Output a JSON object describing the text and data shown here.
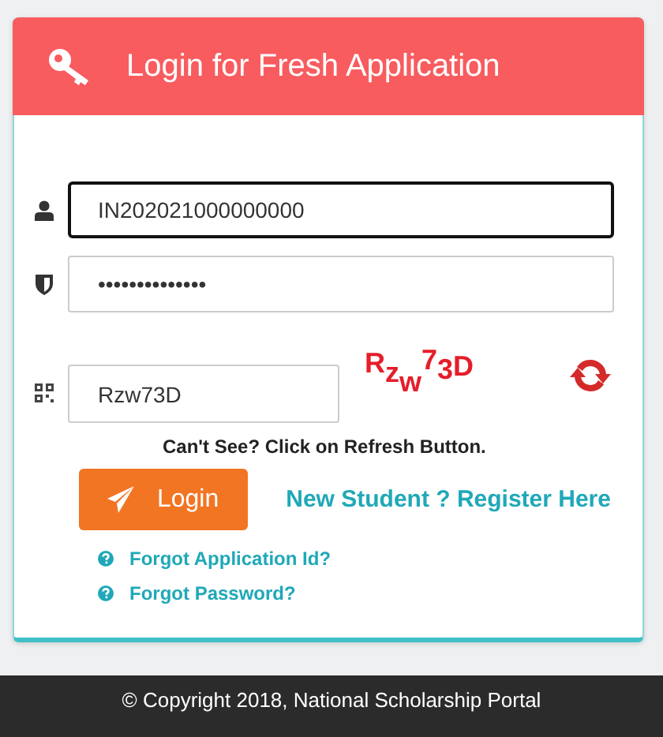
{
  "header": {
    "title": "Login for Fresh Application"
  },
  "fields": [
    {
      "kind": "user",
      "value": "IN202021000000000",
      "focused": true
    },
    {
      "kind": "password",
      "value": "••••••••••••••",
      "focused": false
    }
  ],
  "captcha": {
    "image_text": "Rzw73D",
    "value": "Rzw73D",
    "hint": "Can't See? Click on Refresh Button."
  },
  "login_button": "Login",
  "register_link": "New Student ? Register Here",
  "help_links": [
    "Forgot Application Id?",
    "Forgot Password?"
  ],
  "footer": "© Copyright 2018, National Scholarship Portal"
}
